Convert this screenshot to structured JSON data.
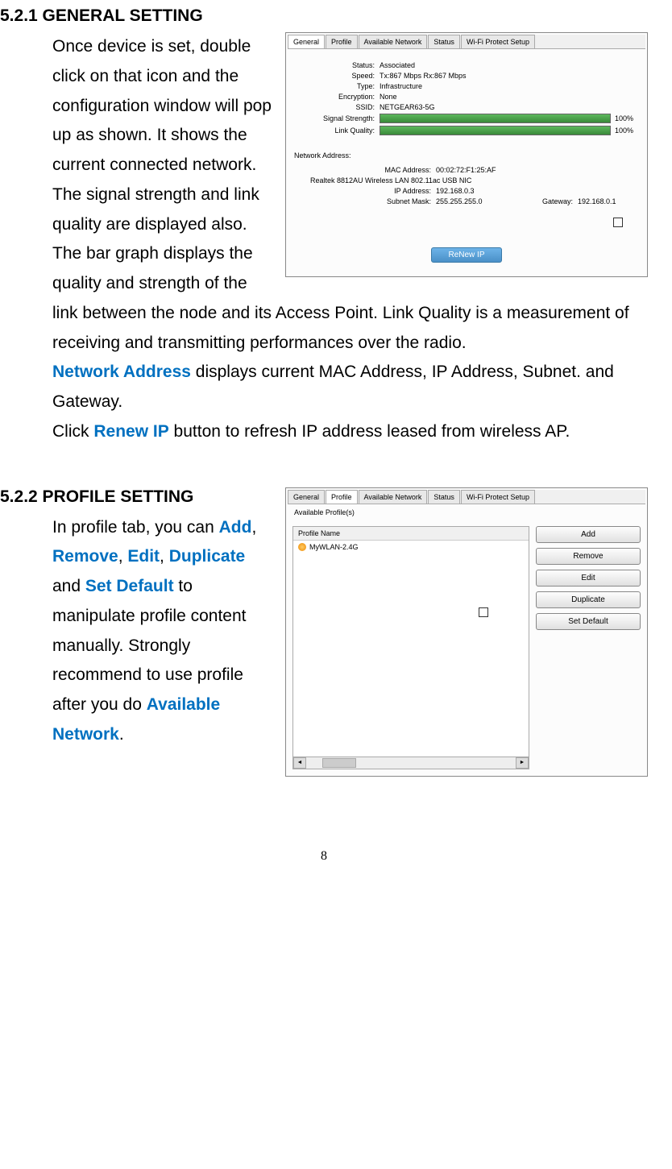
{
  "section1": {
    "heading": "5.2.1 GENERAL SETTING",
    "para1a": "Once device is set, double click on that icon and the configuration window will pop up as shown. It shows the current connected network. The signal strength and link quality are displayed also.",
    "para1b": "The bar graph displays the quality and strength of the link between the node and its Access Point. Link Quality is a measurement of receiving and transmitting performances over the radio.",
    "para2_pre": "Network Address",
    "para2_post": " displays current MAC Address, IP Address, Subnet. and Gateway.",
    "para3_pre": "Click ",
    "para3_mid": "Renew IP",
    "para3_post": " button to refresh IP address leased from wireless AP."
  },
  "figure1": {
    "tabs": [
      "General",
      "Profile",
      "Available Network",
      "Status",
      "Wi-Fi Protect Setup"
    ],
    "active_tab": 0,
    "status_label": "Status:",
    "status_value": "Associated",
    "speed_label": "Speed:",
    "speed_value": "Tx:867 Mbps Rx:867 Mbps",
    "type_label": "Type:",
    "type_value": "Infrastructure",
    "encryption_label": "Encryption:",
    "encryption_value": "None",
    "ssid_label": "SSID:",
    "ssid_value": "NETGEAR63-5G",
    "signal_label": "Signal Strength:",
    "signal_percent": "100%",
    "quality_label": "Link Quality:",
    "quality_percent": "100%",
    "network_address_heading": "Network Address:",
    "mac_label": "MAC Address:",
    "mac_value": "00:02:72:F1:25:AF",
    "adapter_label": "Realtek 8812AU Wireless LAN 802.11ac USB NIC",
    "ip_label": "IP Address:",
    "ip_value": "192.168.0.3",
    "subnet_label": "Subnet Mask:",
    "subnet_value": "255.255.255.0",
    "gateway_label": "Gateway:",
    "gateway_value": "192.168.0.1",
    "renew_button": "ReNew IP"
  },
  "section2": {
    "heading": "5.2.2 PROFILE SETTING",
    "para_pre": "In profile tab, you can ",
    "add": "Add",
    "sep1": ", ",
    "remove": "Remove",
    "sep2": ", ",
    "edit": "Edit",
    "sep3": ", ",
    "duplicate": "Duplicate",
    "sep4": " and ",
    "setdefault": "Set Default",
    "para_post": " to manipulate profile content manually. Strongly recommend to use profile after you do ",
    "available_network": "Available Network",
    "period": "."
  },
  "figure2": {
    "tabs": [
      "General",
      "Profile",
      "Available Network",
      "Status",
      "Wi-Fi Protect Setup"
    ],
    "active_tab": 1,
    "group_label": "Available Profile(s)",
    "list_header": "Profile Name",
    "profile_item": "MyWLAN-2.4G",
    "buttons": [
      "Add",
      "Remove",
      "Edit",
      "Duplicate",
      "Set Default"
    ]
  },
  "page_number": "8"
}
